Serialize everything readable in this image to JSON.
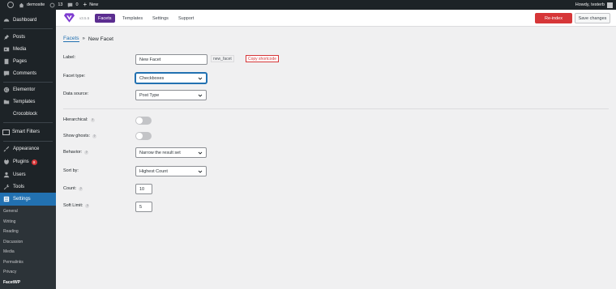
{
  "admin_bar": {
    "site_name": "demosite",
    "updates_count": "13",
    "comments_count": "0",
    "new_label": "New",
    "greeting": "Howdy, testerb"
  },
  "sidebar": {
    "items": [
      {
        "label": "Dashboard",
        "icon": "dashboard-icon"
      },
      {
        "label": "Posts",
        "icon": "pin-icon"
      },
      {
        "label": "Media",
        "icon": "media-icon"
      },
      {
        "label": "Pages",
        "icon": "pages-icon"
      },
      {
        "label": "Comments",
        "icon": "comment-icon"
      },
      {
        "label": "Elementor",
        "icon": "elementor-icon"
      },
      {
        "label": "Templates",
        "icon": "folder-icon"
      },
      {
        "label": "Crocoblock",
        "icon": "crocoblock-icon"
      },
      {
        "label": "Smart Filters",
        "icon": "smart-filters-icon"
      },
      {
        "label": "Appearance",
        "icon": "brush-icon"
      },
      {
        "label": "Plugins",
        "icon": "plug-icon",
        "badge": "9"
      },
      {
        "label": "Users",
        "icon": "user-icon"
      },
      {
        "label": "Tools",
        "icon": "wrench-icon"
      },
      {
        "label": "Settings",
        "icon": "settings-icon",
        "active": true
      }
    ],
    "submenu": [
      "General",
      "Writing",
      "Reading",
      "Discussion",
      "Media",
      "Permalinks",
      "Privacy",
      "FacetWP"
    ]
  },
  "header": {
    "version": "v3.5.5",
    "tabs": [
      "Facets",
      "Templates",
      "Settings",
      "Support"
    ],
    "reindex_label": "Re-index",
    "save_label": "Save changes",
    "accent_color": "#5b2d90",
    "reindex_color": "#d63638"
  },
  "breadcrumb": {
    "parent": "Facets",
    "separator": "»",
    "current": "New Facet"
  },
  "form": {
    "label": {
      "label": "Label:",
      "value": "New Facet",
      "name_chip": "new_facet",
      "copy_shortcode": "Copy shortcode"
    },
    "facet_type": {
      "label": "Facet type:",
      "value": "Checkboxes"
    },
    "data_source": {
      "label": "Data source:",
      "value": "Post Type"
    },
    "hierarchical": {
      "label": "Hierarchical:",
      "on": false
    },
    "show_ghosts": {
      "label": "Show ghosts:",
      "on": false
    },
    "behavior": {
      "label": "Behavior:",
      "value": "Narrow the result set"
    },
    "sort_by": {
      "label": "Sort by:",
      "value": "Highest Count"
    },
    "count": {
      "label": "Count:",
      "value": "10"
    },
    "soft_limit": {
      "label": "Soft Limit:",
      "value": "5"
    },
    "help_glyph": "?"
  }
}
